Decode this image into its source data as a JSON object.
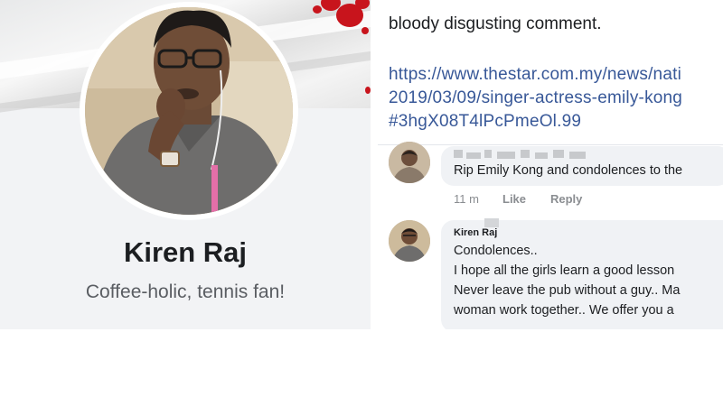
{
  "profile": {
    "name": "Kiren Raj",
    "bio": "Coffee-holic, tennis fan!"
  },
  "post": {
    "text": "bloody disgusting comment.",
    "link_lines": [
      "https://www.thestar.com.my/news/nati",
      "2019/03/09/singer-actress-emily-kong",
      "#3hgX08T4lPcPmeOl.99"
    ]
  },
  "comments": [
    {
      "text": "Rip Emily Kong and condolences to the",
      "time": "11 m",
      "like_label": "Like",
      "reply_label": "Reply"
    },
    {
      "author": "Kiren Raj",
      "lines": [
        "Condolences..",
        "I hope all the girls learn a good  lesson",
        "Never leave the pub without a guy.. Ma",
        "woman work together.. We offer you a"
      ]
    }
  ],
  "colors": {
    "link": "#385898",
    "blood": "#c8141c",
    "bubble": "#f0f2f5"
  }
}
